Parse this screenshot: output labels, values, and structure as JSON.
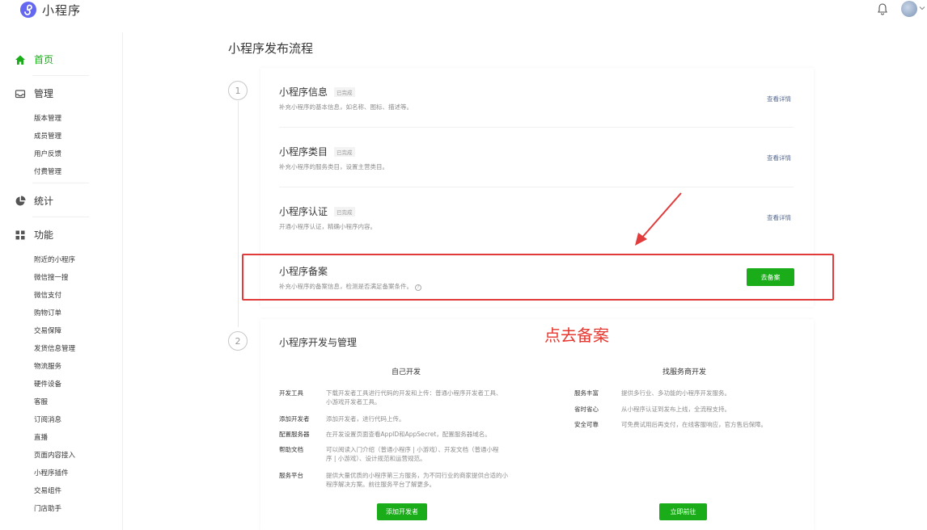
{
  "topbar": {
    "app_name": "小程序"
  },
  "sidebar": {
    "home": "首页",
    "manage": "管理",
    "manage_items": [
      "版本管理",
      "成员管理",
      "用户反馈",
      "付费管理"
    ],
    "stats": "统计",
    "features": "功能",
    "feature_items": [
      "附近的小程序",
      "微信搜一搜",
      "微信支付",
      "购物订单",
      "交易保障",
      "发货信息管理",
      "物流服务",
      "硬件设备",
      "客服",
      "订阅消息",
      "直播",
      "页面内容接入",
      "小程序插件",
      "交易组件",
      "门店助手"
    ]
  },
  "main": {
    "title": "小程序发布流程",
    "step1": "1",
    "step2": "2",
    "rows": [
      {
        "title": "小程序信息",
        "tag": "已完成",
        "desc": "补充小程序的基本信息，如名称、图标、描述等。",
        "link": "查看详情"
      },
      {
        "title": "小程序类目",
        "tag": "已完成",
        "desc": "补充小程序的服务类目，设置主营类目。",
        "link": "查看详情"
      },
      {
        "title": "小程序认证",
        "tag": "已完成",
        "desc": "开通小程序认证，精确小程序内容。",
        "link": "查看详情"
      },
      {
        "title": "小程序备案",
        "desc": "补充小程序的备案信息，检测是否满足备案条件。",
        "button": "去备案"
      }
    ],
    "annotation": "点去备案",
    "dev": {
      "title": "小程序开发与管理",
      "self": {
        "heading": "自己开发",
        "items": [
          {
            "key": "开发工具",
            "val1": "下载开发者工具进行代码的开发和上传：普通小程序开发者工具、",
            "val2": "小游戏开发者工具。"
          },
          {
            "key": "添加开发者",
            "val1": "添加开发者，进行代码上传。"
          },
          {
            "key": "配置服务器",
            "val1": "在开发设置页面查看AppID和AppSecret，配置服务器域名。"
          },
          {
            "key": "帮助文档",
            "val1": "可以阅读入门介绍（普通小程序 | 小游戏）、开发文档（普通小程",
            "val2": "序 | 小游戏）、设计规范和运营规范。"
          },
          {
            "key": "服务平台",
            "val1": "提供大量优质的小程序第三方服务，为不同行业的商家提供合适的小",
            "val2": "程序解决方案。前往服务平台了解更多。"
          }
        ],
        "button": "添加开发者"
      },
      "provider": {
        "heading": "找服务商开发",
        "items": [
          {
            "key": "服务丰富",
            "val": "提供多行业、多功能的小程序开发服务。"
          },
          {
            "key": "省时省心",
            "val": "从小程序认证到发布上线，全流程支持。"
          },
          {
            "key": "安全可靠",
            "val": "可免费试用后再支付，在线客服响应，官方售后保障。"
          }
        ],
        "button": "立即前往"
      }
    }
  },
  "colors": {
    "brand_green": "#1aad19",
    "annotation_red": "#e23b3b",
    "link_blue": "#576b95"
  }
}
